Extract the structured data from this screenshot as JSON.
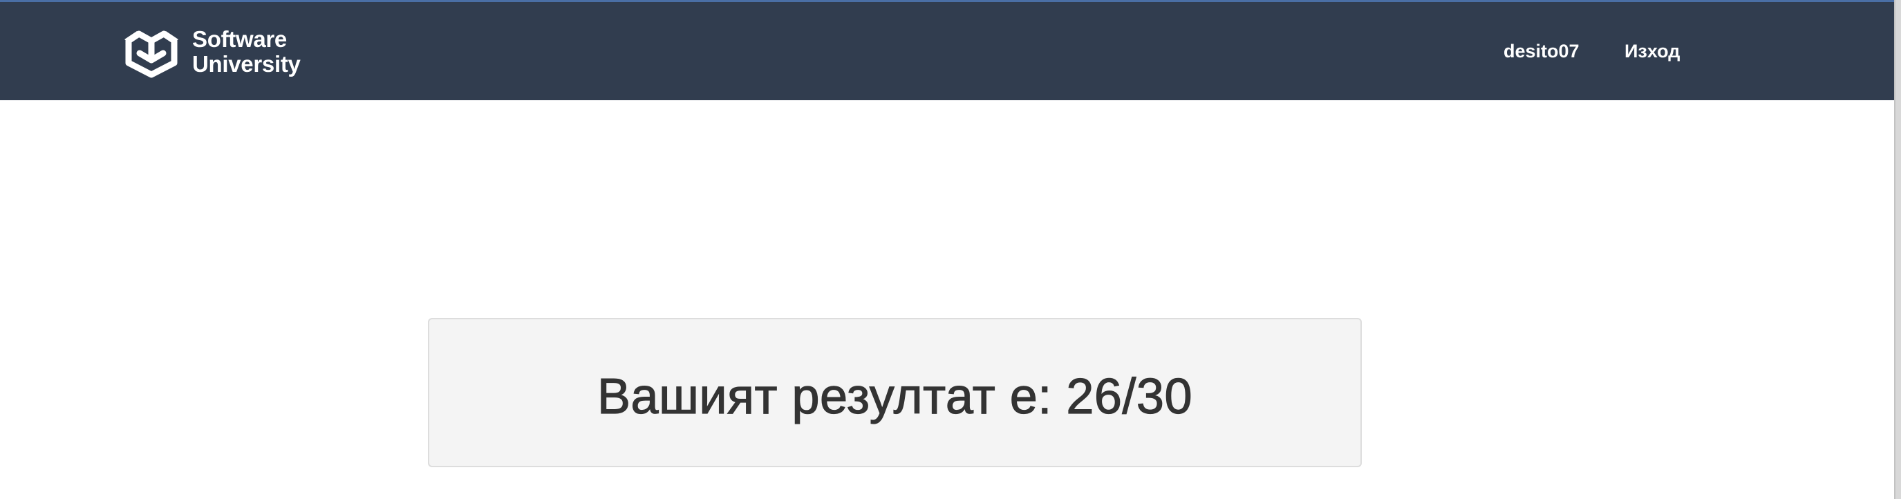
{
  "navbar": {
    "brand": {
      "line1": "Software",
      "line2": "University",
      "logo_icon": "softuni-box-logo-icon"
    },
    "user_link": "desito07",
    "logout_link": "Изход",
    "background_color": "#313d4f"
  },
  "main": {
    "result_text": "Вашият резултат е: 26/30"
  }
}
